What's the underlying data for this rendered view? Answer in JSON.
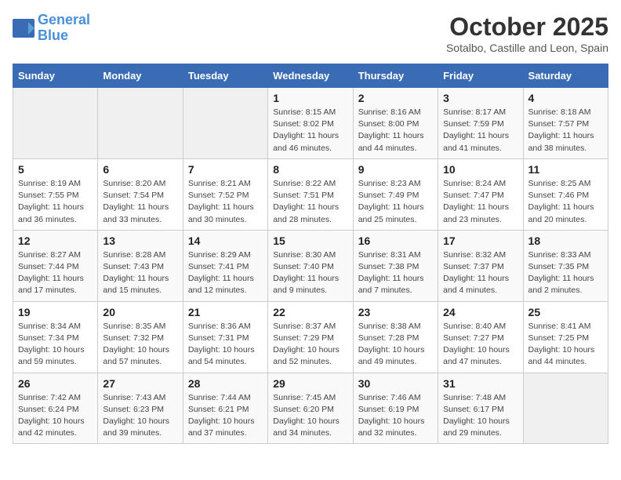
{
  "header": {
    "logo_line1": "General",
    "logo_line2": "Blue",
    "month": "October 2025",
    "location": "Sotalbo, Castille and Leon, Spain"
  },
  "weekdays": [
    "Sunday",
    "Monday",
    "Tuesday",
    "Wednesday",
    "Thursday",
    "Friday",
    "Saturday"
  ],
  "weeks": [
    [
      {
        "day": "",
        "info": ""
      },
      {
        "day": "",
        "info": ""
      },
      {
        "day": "",
        "info": ""
      },
      {
        "day": "1",
        "info": "Sunrise: 8:15 AM\nSunset: 8:02 PM\nDaylight: 11 hours\nand 46 minutes."
      },
      {
        "day": "2",
        "info": "Sunrise: 8:16 AM\nSunset: 8:00 PM\nDaylight: 11 hours\nand 44 minutes."
      },
      {
        "day": "3",
        "info": "Sunrise: 8:17 AM\nSunset: 7:59 PM\nDaylight: 11 hours\nand 41 minutes."
      },
      {
        "day": "4",
        "info": "Sunrise: 8:18 AM\nSunset: 7:57 PM\nDaylight: 11 hours\nand 38 minutes."
      }
    ],
    [
      {
        "day": "5",
        "info": "Sunrise: 8:19 AM\nSunset: 7:55 PM\nDaylight: 11 hours\nand 36 minutes."
      },
      {
        "day": "6",
        "info": "Sunrise: 8:20 AM\nSunset: 7:54 PM\nDaylight: 11 hours\nand 33 minutes."
      },
      {
        "day": "7",
        "info": "Sunrise: 8:21 AM\nSunset: 7:52 PM\nDaylight: 11 hours\nand 30 minutes."
      },
      {
        "day": "8",
        "info": "Sunrise: 8:22 AM\nSunset: 7:51 PM\nDaylight: 11 hours\nand 28 minutes."
      },
      {
        "day": "9",
        "info": "Sunrise: 8:23 AM\nSunset: 7:49 PM\nDaylight: 11 hours\nand 25 minutes."
      },
      {
        "day": "10",
        "info": "Sunrise: 8:24 AM\nSunset: 7:47 PM\nDaylight: 11 hours\nand 23 minutes."
      },
      {
        "day": "11",
        "info": "Sunrise: 8:25 AM\nSunset: 7:46 PM\nDaylight: 11 hours\nand 20 minutes."
      }
    ],
    [
      {
        "day": "12",
        "info": "Sunrise: 8:27 AM\nSunset: 7:44 PM\nDaylight: 11 hours\nand 17 minutes."
      },
      {
        "day": "13",
        "info": "Sunrise: 8:28 AM\nSunset: 7:43 PM\nDaylight: 11 hours\nand 15 minutes."
      },
      {
        "day": "14",
        "info": "Sunrise: 8:29 AM\nSunset: 7:41 PM\nDaylight: 11 hours\nand 12 minutes."
      },
      {
        "day": "15",
        "info": "Sunrise: 8:30 AM\nSunset: 7:40 PM\nDaylight: 11 hours\nand 9 minutes."
      },
      {
        "day": "16",
        "info": "Sunrise: 8:31 AM\nSunset: 7:38 PM\nDaylight: 11 hours\nand 7 minutes."
      },
      {
        "day": "17",
        "info": "Sunrise: 8:32 AM\nSunset: 7:37 PM\nDaylight: 11 hours\nand 4 minutes."
      },
      {
        "day": "18",
        "info": "Sunrise: 8:33 AM\nSunset: 7:35 PM\nDaylight: 11 hours\nand 2 minutes."
      }
    ],
    [
      {
        "day": "19",
        "info": "Sunrise: 8:34 AM\nSunset: 7:34 PM\nDaylight: 10 hours\nand 59 minutes."
      },
      {
        "day": "20",
        "info": "Sunrise: 8:35 AM\nSunset: 7:32 PM\nDaylight: 10 hours\nand 57 minutes."
      },
      {
        "day": "21",
        "info": "Sunrise: 8:36 AM\nSunset: 7:31 PM\nDaylight: 10 hours\nand 54 minutes."
      },
      {
        "day": "22",
        "info": "Sunrise: 8:37 AM\nSunset: 7:29 PM\nDaylight: 10 hours\nand 52 minutes."
      },
      {
        "day": "23",
        "info": "Sunrise: 8:38 AM\nSunset: 7:28 PM\nDaylight: 10 hours\nand 49 minutes."
      },
      {
        "day": "24",
        "info": "Sunrise: 8:40 AM\nSunset: 7:27 PM\nDaylight: 10 hours\nand 47 minutes."
      },
      {
        "day": "25",
        "info": "Sunrise: 8:41 AM\nSunset: 7:25 PM\nDaylight: 10 hours\nand 44 minutes."
      }
    ],
    [
      {
        "day": "26",
        "info": "Sunrise: 7:42 AM\nSunset: 6:24 PM\nDaylight: 10 hours\nand 42 minutes."
      },
      {
        "day": "27",
        "info": "Sunrise: 7:43 AM\nSunset: 6:23 PM\nDaylight: 10 hours\nand 39 minutes."
      },
      {
        "day": "28",
        "info": "Sunrise: 7:44 AM\nSunset: 6:21 PM\nDaylight: 10 hours\nand 37 minutes."
      },
      {
        "day": "29",
        "info": "Sunrise: 7:45 AM\nSunset: 6:20 PM\nDaylight: 10 hours\nand 34 minutes."
      },
      {
        "day": "30",
        "info": "Sunrise: 7:46 AM\nSunset: 6:19 PM\nDaylight: 10 hours\nand 32 minutes."
      },
      {
        "day": "31",
        "info": "Sunrise: 7:48 AM\nSunset: 6:17 PM\nDaylight: 10 hours\nand 29 minutes."
      },
      {
        "day": "",
        "info": ""
      }
    ]
  ]
}
